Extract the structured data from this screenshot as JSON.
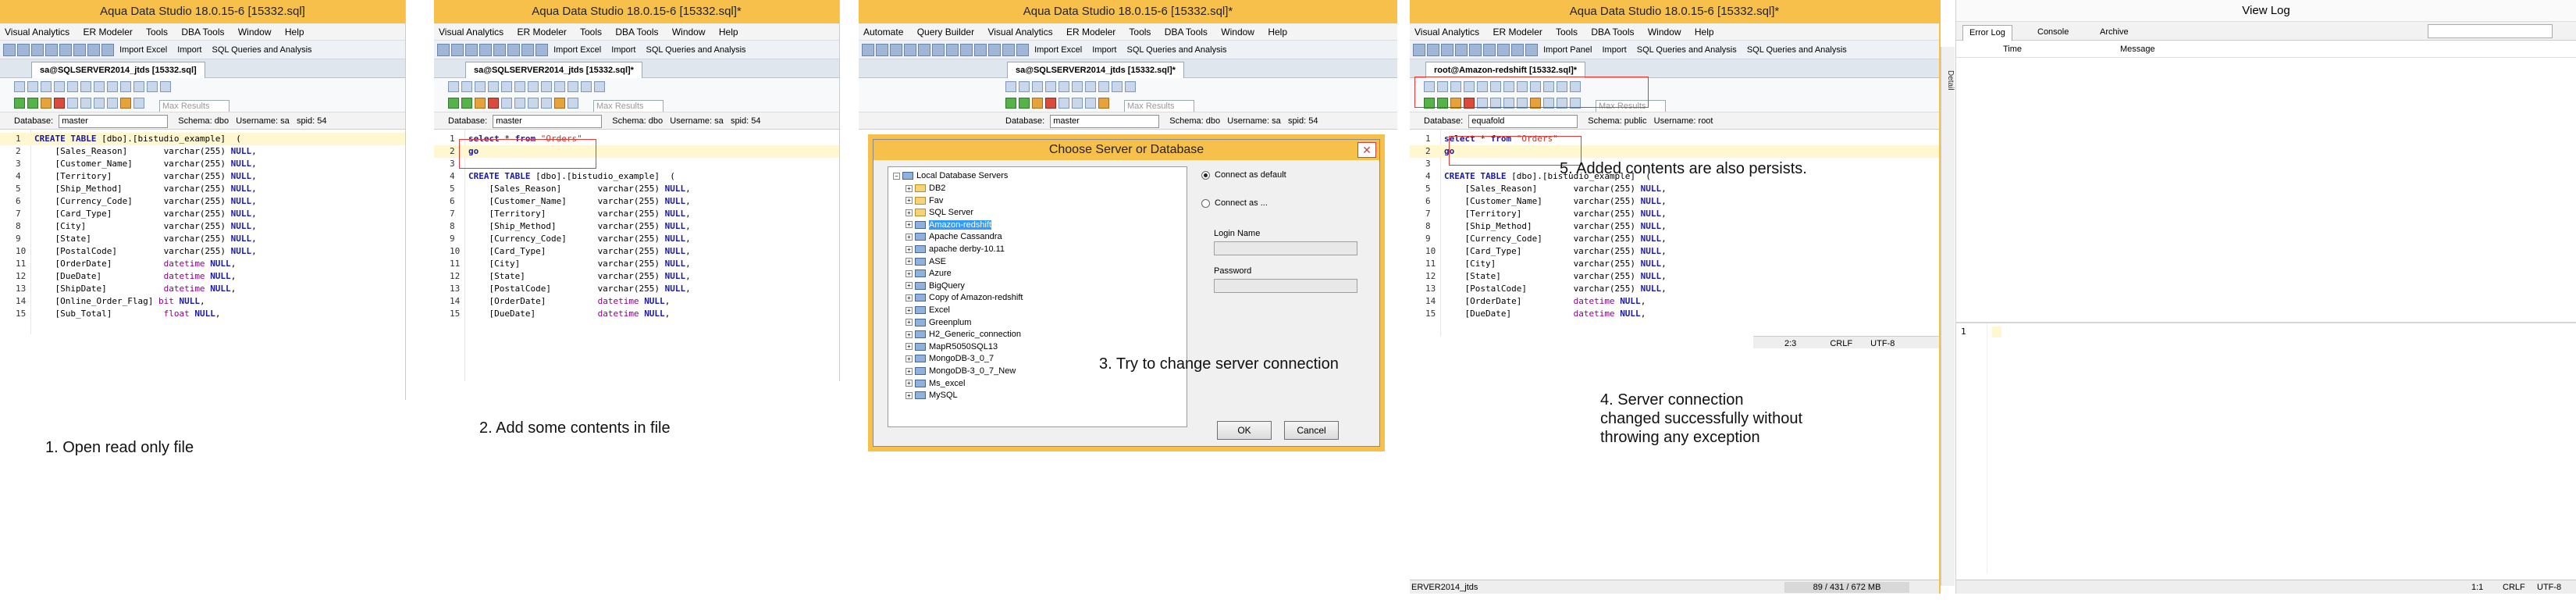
{
  "colors": {
    "titlebar": "#f6c04a",
    "selection": "#3399ff",
    "annotation_box": "#e53935"
  },
  "app_title_1": "Aqua Data Studio 18.0.15-6 [15332.sql]",
  "app_title_2": "Aqua Data Studio 18.0.15-6 [15332.sql]*",
  "app_title_3": "Aqua Data Studio 18.0.15-6 [15332.sql]*",
  "app_title_4": "Aqua Data Studio 18.0.15-6 [15332.sql]*",
  "menu": {
    "p1": [
      "Visual Analytics",
      "ER Modeler",
      "Tools",
      "DBA Tools",
      "Window",
      "Help"
    ],
    "p3": [
      "Automate",
      "Query Builder",
      "Visual Analytics",
      "ER Modeler",
      "Tools",
      "DBA Tools",
      "Window",
      "Help"
    ]
  },
  "toolbar": {
    "import_excel": "Import Excel",
    "import": "Import",
    "sql_qa": "SQL Queries and Analysis",
    "import_panel": "Import Panel"
  },
  "tabs": {
    "sa_read": "sa@SQLSERVER2014_jtds [15332.sql]",
    "sa_mod": "sa@SQLSERVER2014_jtds [15332.sql]*",
    "root": "root@Amazon-redshift [15332.sql]*"
  },
  "dbrow": {
    "label": "Database:",
    "db_master": "master",
    "db_equafold": "equafold",
    "schema_dbo": "Schema: dbo",
    "user_sa": "Username: sa",
    "spid": "spid: 54",
    "schema_public": "Schema: public",
    "user_root": "Username: root",
    "max_results": "Max Results"
  },
  "code_ro": [
    [
      "1",
      "CREATE TABLE [dbo].[bistudio_example]  ("
    ],
    [
      "2",
      "    [Sales_Reason]       varchar(255) NULL,"
    ],
    [
      "3",
      "    [Customer_Name]      varchar(255) NULL,"
    ],
    [
      "4",
      "    [Territory]          varchar(255) NULL,"
    ],
    [
      "5",
      "    [Ship_Method]        varchar(255) NULL,"
    ],
    [
      "6",
      "    [Currency_Code]      varchar(255) NULL,"
    ],
    [
      "7",
      "    [Card_Type]          varchar(255) NULL,"
    ],
    [
      "8",
      "    [City]               varchar(255) NULL,"
    ],
    [
      "9",
      "    [State]              varchar(255) NULL,"
    ],
    [
      "10",
      "    [PostalCode]         varchar(255) NULL,"
    ],
    [
      "11",
      "    [OrderDate]          datetime NULL,"
    ],
    [
      "12",
      "    [DueDate]            datetime NULL,"
    ],
    [
      "13",
      "    [ShipDate]           datetime NULL,"
    ],
    [
      "14",
      "    [Online_Order_Flag] bit NULL,"
    ],
    [
      "15",
      "    [Sub_Total]          float NULL,"
    ]
  ],
  "code_mod": [
    [
      "1",
      "select * from \"Orders\""
    ],
    [
      "2",
      "go"
    ],
    [
      "3",
      ""
    ],
    [
      "4",
      "CREATE TABLE [dbo].[bistudio_example]  ("
    ],
    [
      "5",
      "    [Sales_Reason]       varchar(255) NULL,"
    ],
    [
      "6",
      "    [Customer_Name]      varchar(255) NULL,"
    ],
    [
      "7",
      "    [Territory]          varchar(255) NULL,"
    ],
    [
      "8",
      "    [Ship_Method]        varchar(255) NULL,"
    ],
    [
      "9",
      "    [Currency_Code]      varchar(255) NULL,"
    ],
    [
      "10",
      "    [Card_Type]          varchar(255) NULL,"
    ],
    [
      "11",
      "    [City]               varchar(255) NULL,"
    ],
    [
      "12",
      "    [State]              varchar(255) NULL,"
    ],
    [
      "13",
      "    [PostalCode]         varchar(255) NULL,"
    ],
    [
      "14",
      "    [OrderDate]          datetime NULL,"
    ],
    [
      "15",
      "    [DueDate]            datetime NULL,"
    ]
  ],
  "annotations": {
    "a1": "1. Open read only file",
    "a2": "2. Add some contents in file",
    "a3": "3. Try to change server connection",
    "a4_1": "4. Server connection",
    "a4_2": "changed successfully without",
    "a4_3": "throwing any exception",
    "a5": "5. Added contents are also persists."
  },
  "dialog": {
    "title": "Choose Server or Database",
    "tree_root": "Local Database Servers",
    "servers": [
      "DB2",
      "Fav",
      "SQL Server",
      "Amazon-redshift",
      "Apache Cassandra",
      "apache derby-10.11",
      "ASE",
      "Azure",
      "BigQuery",
      "Copy of Amazon-redshift",
      "Excel",
      "Greenplum",
      "H2_Generic_connection",
      "MapR5050SQL13",
      "MongoDB-3_0_7",
      "MongoDB-3_0_7_New",
      "Ms_excel",
      "MySQL"
    ],
    "selected": "Amazon-redshift",
    "connect_default": "Connect as default",
    "connect_as": "Connect as ...",
    "login_name": "Login Name",
    "password": "Password",
    "ok": "OK",
    "cancel": "Cancel"
  },
  "status": {
    "pos": "2:3",
    "crlf": "CRLF",
    "enc": "UTF-8",
    "mem": "89 / 431 / 672 MB",
    "conn": "ERVER2014_jtds",
    "log_pos": "1:1",
    "log_crlf": "CRLF",
    "log_enc": "UTF-8"
  },
  "log": {
    "title": "View Log",
    "tabs": [
      "Error Log",
      "Console",
      "Archive"
    ],
    "col_time": "Time",
    "col_msg": "Message",
    "sidebar": "Detail",
    "line1": "1"
  }
}
